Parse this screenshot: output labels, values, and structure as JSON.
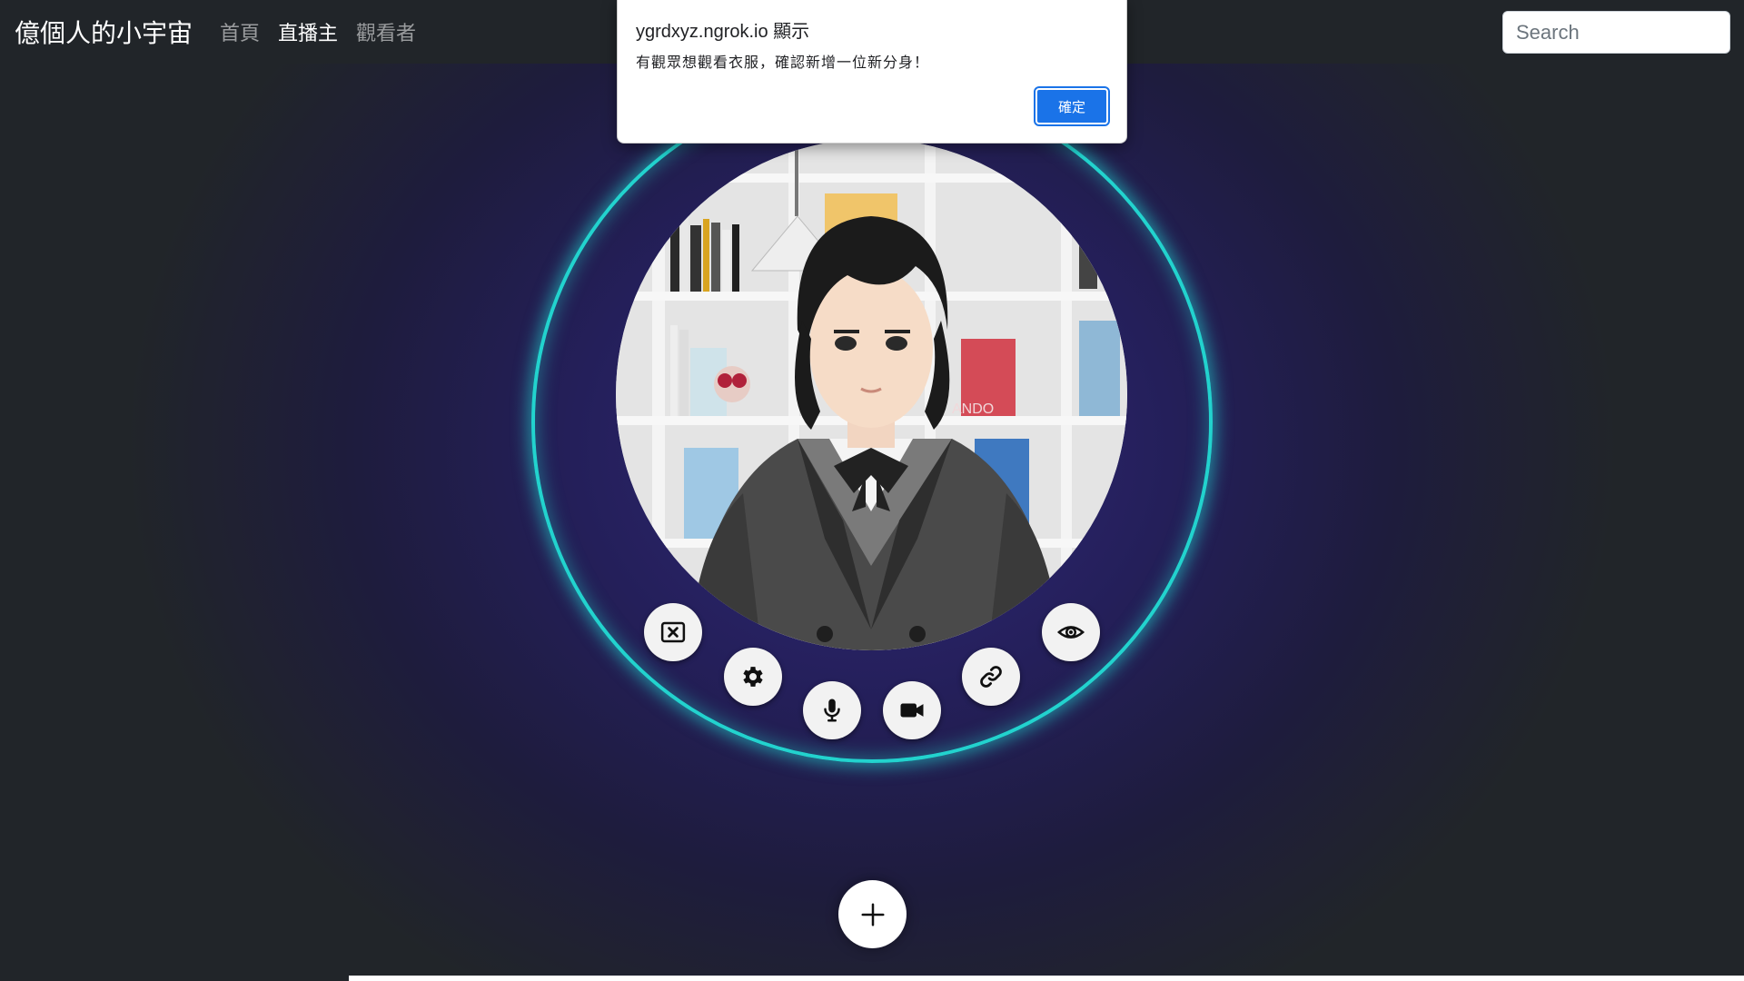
{
  "navbar": {
    "brand": "億個人的小宇宙",
    "links": [
      {
        "label": "首頁",
        "active": false
      },
      {
        "label": "直播主",
        "active": true
      },
      {
        "label": "觀看者",
        "active": false
      }
    ],
    "search_placeholder": "Search"
  },
  "dialog": {
    "title": "ygrdxyz.ngrok.io 顯示",
    "message": "有觀眾想觀看衣服，確認新增一位新分身！",
    "ok_label": "確定"
  },
  "avatar_image": {
    "book_text": "ANDO"
  },
  "controls": [
    {
      "name": "close-box-button",
      "icon": "close-box-icon"
    },
    {
      "name": "settings-button",
      "icon": "gear-icon"
    },
    {
      "name": "microphone-button",
      "icon": "microphone-icon"
    },
    {
      "name": "camera-button",
      "icon": "video-camera-icon"
    },
    {
      "name": "link-button",
      "icon": "link-icon"
    },
    {
      "name": "eye-button",
      "icon": "eye-icon"
    }
  ],
  "add_button": {
    "icon": "plus-icon"
  },
  "colors": {
    "navbar_bg": "#212529",
    "ring": "#22d3ce",
    "stage_center": "#312a78",
    "dialog_ok": "#1a73e8"
  }
}
